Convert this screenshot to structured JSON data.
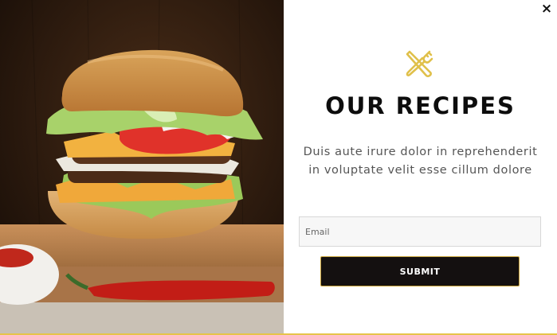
{
  "popup": {
    "close_label": "×",
    "title": "OUR RECIPES",
    "description": "Duis aute irure dolor in reprehenderit in voluptate velit esse cillum dolore",
    "email_placeholder": "Email",
    "submit_label": "SUBMIT",
    "logo_icon": "fork-knife-crossed-icon",
    "accent_color": "#e0c04a"
  },
  "image": {
    "subject": "burger-photo"
  }
}
